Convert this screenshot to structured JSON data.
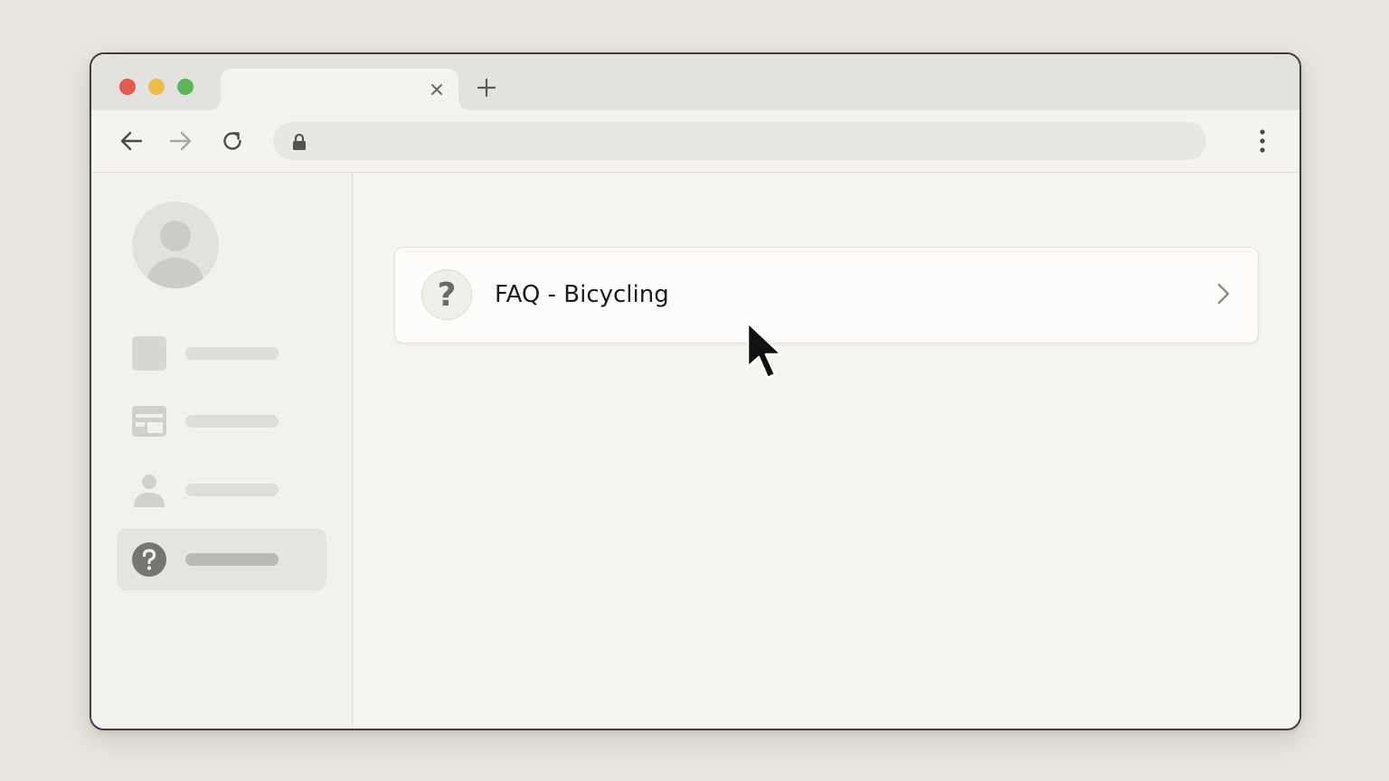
{
  "window": {
    "traffic_lights": {
      "close_color": "#e25c4f",
      "minimize_color": "#e9bf4a",
      "maximize_color": "#5cb65a"
    },
    "tab": {
      "title": "",
      "close_icon": "close-icon"
    },
    "new_tab_icon": "plus-icon"
  },
  "toolbar": {
    "back_icon": "arrow-left-icon",
    "forward_icon": "arrow-right-icon",
    "reload_icon": "reload-icon",
    "address": {
      "lock_icon": "lock-icon",
      "url": ""
    },
    "menu_icon": "more-vertical-icon"
  },
  "sidebar": {
    "avatar_icon": "user-avatar-icon",
    "items": [
      {
        "icon": "square-icon",
        "label": "",
        "active": false
      },
      {
        "icon": "card-icon",
        "label": "",
        "active": false
      },
      {
        "icon": "person-icon",
        "label": "",
        "active": false
      },
      {
        "icon": "help-circle-icon",
        "label": "",
        "active": true
      }
    ]
  },
  "main": {
    "faq_item": {
      "icon_glyph": "?",
      "title": "FAQ - Bicycling",
      "chevron_icon": "chevron-right-icon"
    }
  },
  "cursor": {
    "icon": "mouse-pointer-icon"
  }
}
